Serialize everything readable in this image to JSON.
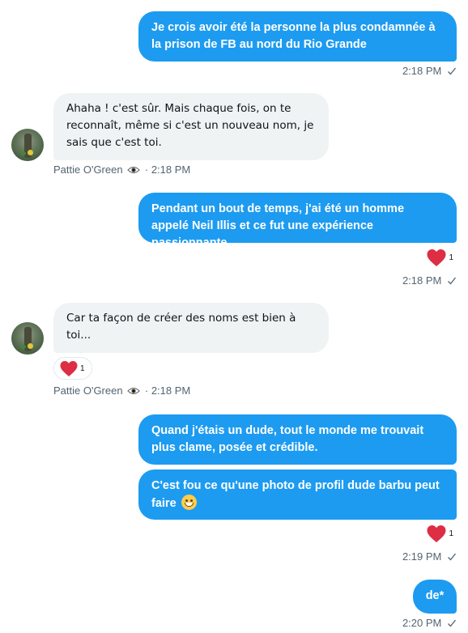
{
  "conversation": {
    "messages": [
      {
        "sender": "self",
        "text": "Je crois avoir été la personne la plus condamnée à la prison de FB au nord du Rio Grande",
        "time": "2:18 PM"
      },
      {
        "sender": "other",
        "name": "Pattie O'Green",
        "text": "Ahaha ! c'est sûr. Mais chaque fois, on te reconnaît, même si c'est un nouveau nom, je sais que c'est toi.",
        "time": "2:18 PM"
      },
      {
        "sender": "self",
        "text": "Pendant un bout de temps, j'ai été un homme appelé Neil Illis et ce fut une expérience passionnante",
        "time": "2:18 PM",
        "reaction_count": "1"
      },
      {
        "sender": "other",
        "name": "Pattie O'Green",
        "text": "Car ta façon de créer des noms est bien à toi...",
        "time": "2:18 PM",
        "reaction_count": "1"
      },
      {
        "sender": "self",
        "text": "Quand j'étais un dude, tout le monde me trouvait plus clame, posée et crédible."
      },
      {
        "sender": "self",
        "text": "C'est fou ce qu'une photo de profil dude barbu peut faire",
        "time": "2:19 PM",
        "reaction_count": "1"
      },
      {
        "sender": "self",
        "text": "de*",
        "time": "2:20 PM"
      }
    ]
  },
  "separator": "·",
  "colors": {
    "accent": "#1d9bf0",
    "incoming_bubble": "#eff3f4",
    "muted": "#536471",
    "heart": "#f91880"
  },
  "icons": {
    "read": "checkmark-icon",
    "reaction": "heart-icon",
    "viewer": "eye-icon",
    "emoji": "grinning-emoji-icon"
  }
}
